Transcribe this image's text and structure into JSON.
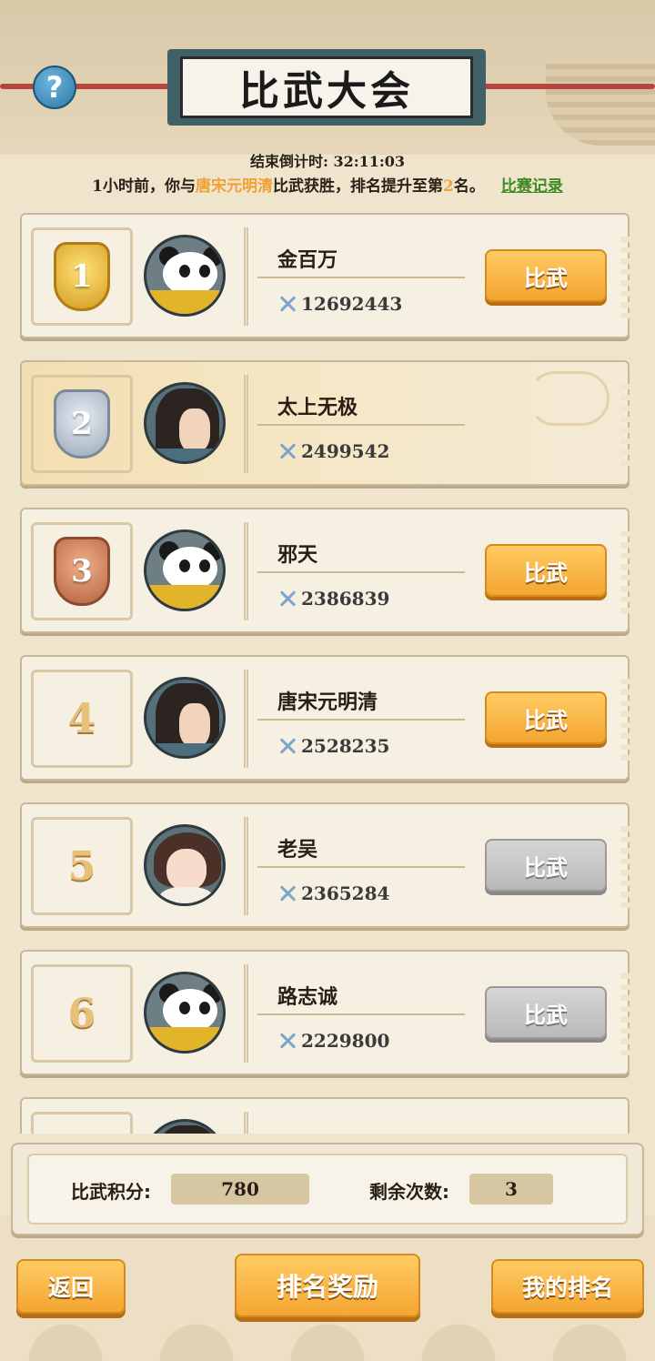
{
  "header": {
    "title": "比武大会",
    "help_symbol": "?"
  },
  "countdown": {
    "label": "结束倒计时:",
    "value": "32:11:03"
  },
  "news": {
    "prefix": "1小时前，你与",
    "opponent": "唐宋元明清",
    "middle": "比武获胜，排名提升至第",
    "rank": "2",
    "suffix": "名。",
    "record_link": "比赛记录"
  },
  "ranking": [
    {
      "rank": "1",
      "medal": "gold",
      "avatar": "panda-avatar",
      "name": "金百万",
      "power": "12692443",
      "button": "比武",
      "button_state": "active",
      "is_self": false
    },
    {
      "rank": "2",
      "medal": "silver",
      "avatar": "swordsman-avatar",
      "name": "太上无极",
      "power": "2499542",
      "button": "",
      "button_state": "none",
      "is_self": true
    },
    {
      "rank": "3",
      "medal": "bronze",
      "avatar": "panda-avatar",
      "name": "邪天",
      "power": "2386839",
      "button": "比武",
      "button_state": "active",
      "is_self": false
    },
    {
      "rank": "4",
      "medal": "none",
      "avatar": "swordsman-avatar",
      "name": "唐宋元明清",
      "power": "2528235",
      "button": "比武",
      "button_state": "active",
      "is_self": false
    },
    {
      "rank": "5",
      "medal": "none",
      "avatar": "girl-avatar",
      "name": "老吴",
      "power": "2365284",
      "button": "比武",
      "button_state": "disabled",
      "is_self": false
    },
    {
      "rank": "6",
      "medal": "none",
      "avatar": "panda-avatar",
      "name": "路志诚",
      "power": "2229800",
      "button": "比武",
      "button_state": "disabled",
      "is_self": false
    }
  ],
  "stats": {
    "points_label": "比武积分:",
    "points_value": "780",
    "remaining_label": "剩余次数:",
    "remaining_value": "3"
  },
  "footer": {
    "back": "返回",
    "rewards": "排名奖励",
    "my_rank": "我的排名"
  },
  "colors": {
    "accent_orange": "#f4a531",
    "highlight_name": "#f0a034",
    "link_green": "#3c8a20",
    "disabled_gray": "#b9b9b9"
  }
}
